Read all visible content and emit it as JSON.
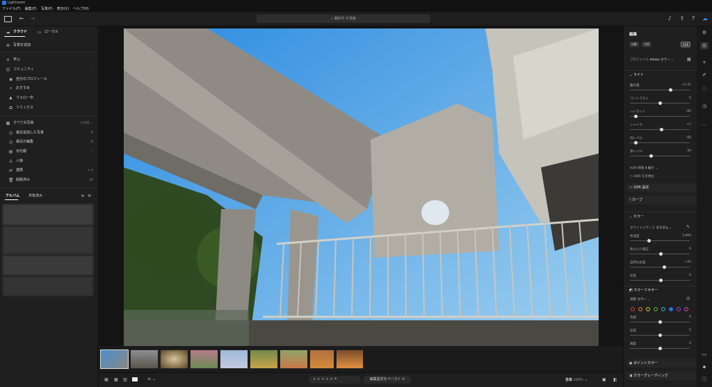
{
  "app": {
    "title": "Lightroom"
  },
  "menu": [
    "ファイル(F)",
    "編集(E)",
    "写真(P)",
    "表示(V)",
    "ヘルプ(H)"
  ],
  "search": {
    "placeholder": "撮影所 を検索"
  },
  "left": {
    "cloud_tab": "クラウド",
    "local_tab": "ローカル",
    "add_photos": "写真を追加",
    "learn": "学ぶ",
    "community": "コミュニティ",
    "community_items": [
      "自分のプロフィール",
      "おすすめ",
      "フォロー中",
      "リミックス"
    ],
    "all_photos": "すべての写真",
    "all_photos_count": "3,926",
    "photo_items": [
      {
        "label": "最近追加した写真",
        "count": "8"
      },
      {
        "label": "最近の編集",
        "count": "8"
      },
      {
        "label": "日付順",
        "count": ""
      },
      {
        "label": "人物",
        "count": ""
      },
      {
        "label": "連携",
        "count": "4"
      },
      {
        "label": "削除済み",
        "count": "46"
      }
    ],
    "albums_tab": "アルバム",
    "shared_tab": "共有済み"
  },
  "right": {
    "edit_title": "編集",
    "auto_btn": "自動",
    "bw_btn": "白黒",
    "hdr_btn": "HDR",
    "profile_label": "プロファイル",
    "profile_value": "Adobe カラー",
    "light_title": "ライト",
    "light_sliders": [
      {
        "label": "露光量",
        "value": "+1.31",
        "pos": 0.68
      },
      {
        "label": "コントラスト",
        "value": "0",
        "pos": 0.5
      },
      {
        "label": "ハイライト",
        "value": "-80",
        "pos": 0.1
      },
      {
        "label": "シャドウ",
        "value": "+7",
        "pos": 0.53
      },
      {
        "label": "白レベル",
        "value": "-80",
        "pos": 0.1
      },
      {
        "label": "黒レベル",
        "value": "-30",
        "pos": 0.35
      }
    ],
    "hdr_label": "HDR 制限",
    "hdr_value": "4 絞り",
    "hdr_preview": "HDR を可視化",
    "sdr_settings": "SDR 設定",
    "curve_title": "カーブ",
    "color_title": "カラー",
    "wb_label": "ホワイトバランス",
    "wb_value": "カスタム",
    "color_sliders": [
      {
        "label": "色温度",
        "value": "5,800",
        "pos": 0.32
      },
      {
        "label": "色かぶり補正",
        "value": "0",
        "pos": 0.52
      },
      {
        "label": "自然な彩度",
        "value": "+20",
        "pos": 0.58
      },
      {
        "label": "彩度",
        "value": "0",
        "pos": 0.52
      }
    ],
    "mixer_title": "カラーミキサー",
    "mixer_target_label": "調整",
    "mixer_target_value": "カラー",
    "mixer_colors": [
      "#e23b3b",
      "#e08a2b",
      "#e0d02b",
      "#58c13c",
      "#2bc1c1",
      "#2b6de0",
      "#9a4ee0",
      "#d54ec4"
    ],
    "mixer_sliders": [
      {
        "label": "色相",
        "value": "0",
        "pos": 0.5
      },
      {
        "label": "彩度",
        "value": "0",
        "pos": 0.5
      },
      {
        "label": "輝度",
        "value": "0",
        "pos": 0.5
      }
    ],
    "point_color": "ポイントカラー",
    "color_grading": "カラーグレーディング"
  },
  "bottom": {
    "paste_btn": "編集設定をペースト",
    "zoom_label": "全体",
    "zoom_value": "100%",
    "stars": "★ ★ ★ ★ ★"
  }
}
